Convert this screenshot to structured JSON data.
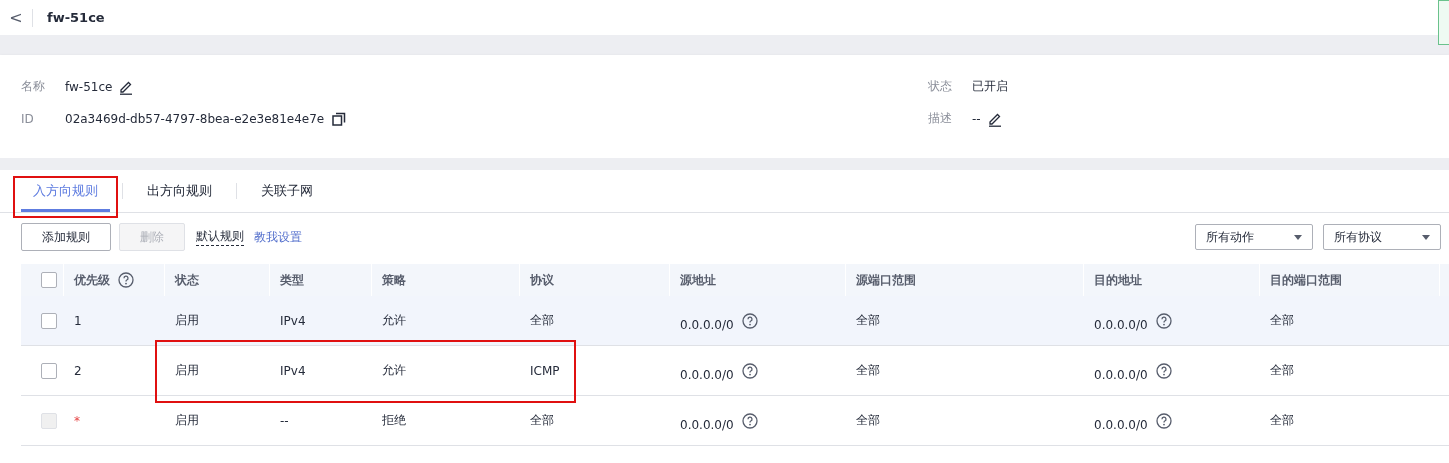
{
  "header": {
    "back": "<",
    "title": "fw-51ce"
  },
  "details": {
    "left": [
      {
        "label": "名称",
        "value": "fw-51ce",
        "editable": true,
        "copyable": false
      },
      {
        "label": "ID",
        "value": "02a3469d-db57-4797-8bea-e2e3e81e4e7e",
        "editable": false,
        "copyable": true
      }
    ],
    "right": [
      {
        "label": "状态",
        "value": "已开启",
        "editable": false,
        "copyable": false
      },
      {
        "label": "描述",
        "value": "--",
        "editable": true,
        "copyable": false
      }
    ]
  },
  "tabs": [
    {
      "label": "入方向规则",
      "selected": true,
      "annotated": true
    },
    {
      "label": "出方向规则",
      "selected": false,
      "annotated": false
    },
    {
      "label": "关联子网",
      "selected": false,
      "annotated": false
    }
  ],
  "toolbar": {
    "buttons": [
      {
        "label": "添加规则",
        "disabled": false
      },
      {
        "label": "删除",
        "disabled": true
      }
    ],
    "default_rules": "默认规则",
    "help_link": "教我设置",
    "filters": [
      "所有动作",
      "所有协议"
    ]
  },
  "table": {
    "select_all": {
      "checked": false
    },
    "columns": [
      {
        "label": "优先级",
        "help": true
      },
      {
        "label": "状态",
        "help": false
      },
      {
        "label": "类型",
        "help": false
      },
      {
        "label": "策略",
        "help": false
      },
      {
        "label": "协议",
        "help": false
      },
      {
        "label": "源地址",
        "help": false
      },
      {
        "label": "源端口范围",
        "help": false
      },
      {
        "label": "目的地址",
        "help": false
      },
      {
        "label": "目的端口范围",
        "help": false
      }
    ],
    "rows": [
      {
        "checked": false,
        "checkbox_disabled": false,
        "hovered": true,
        "annotated": false,
        "default_rule": false,
        "cells": [
          "1",
          "启用",
          "IPv4",
          "允许",
          "全部",
          "0.0.0.0/0",
          "全部",
          "0.0.0.0/0",
          "全部"
        ]
      },
      {
        "checked": false,
        "checkbox_disabled": false,
        "hovered": false,
        "annotated": true,
        "default_rule": false,
        "cells": [
          "2",
          "启用",
          "IPv4",
          "允许",
          "ICMP",
          "0.0.0.0/0",
          "全部",
          "0.0.0.0/0",
          "全部"
        ]
      },
      {
        "checked": false,
        "checkbox_disabled": true,
        "hovered": false,
        "annotated": false,
        "default_rule": true,
        "cells": [
          "*",
          "启用",
          "--",
          "拒绝",
          "全部",
          "0.0.0.0/0",
          "全部",
          "0.0.0.0/0",
          "全部"
        ]
      }
    ]
  }
}
